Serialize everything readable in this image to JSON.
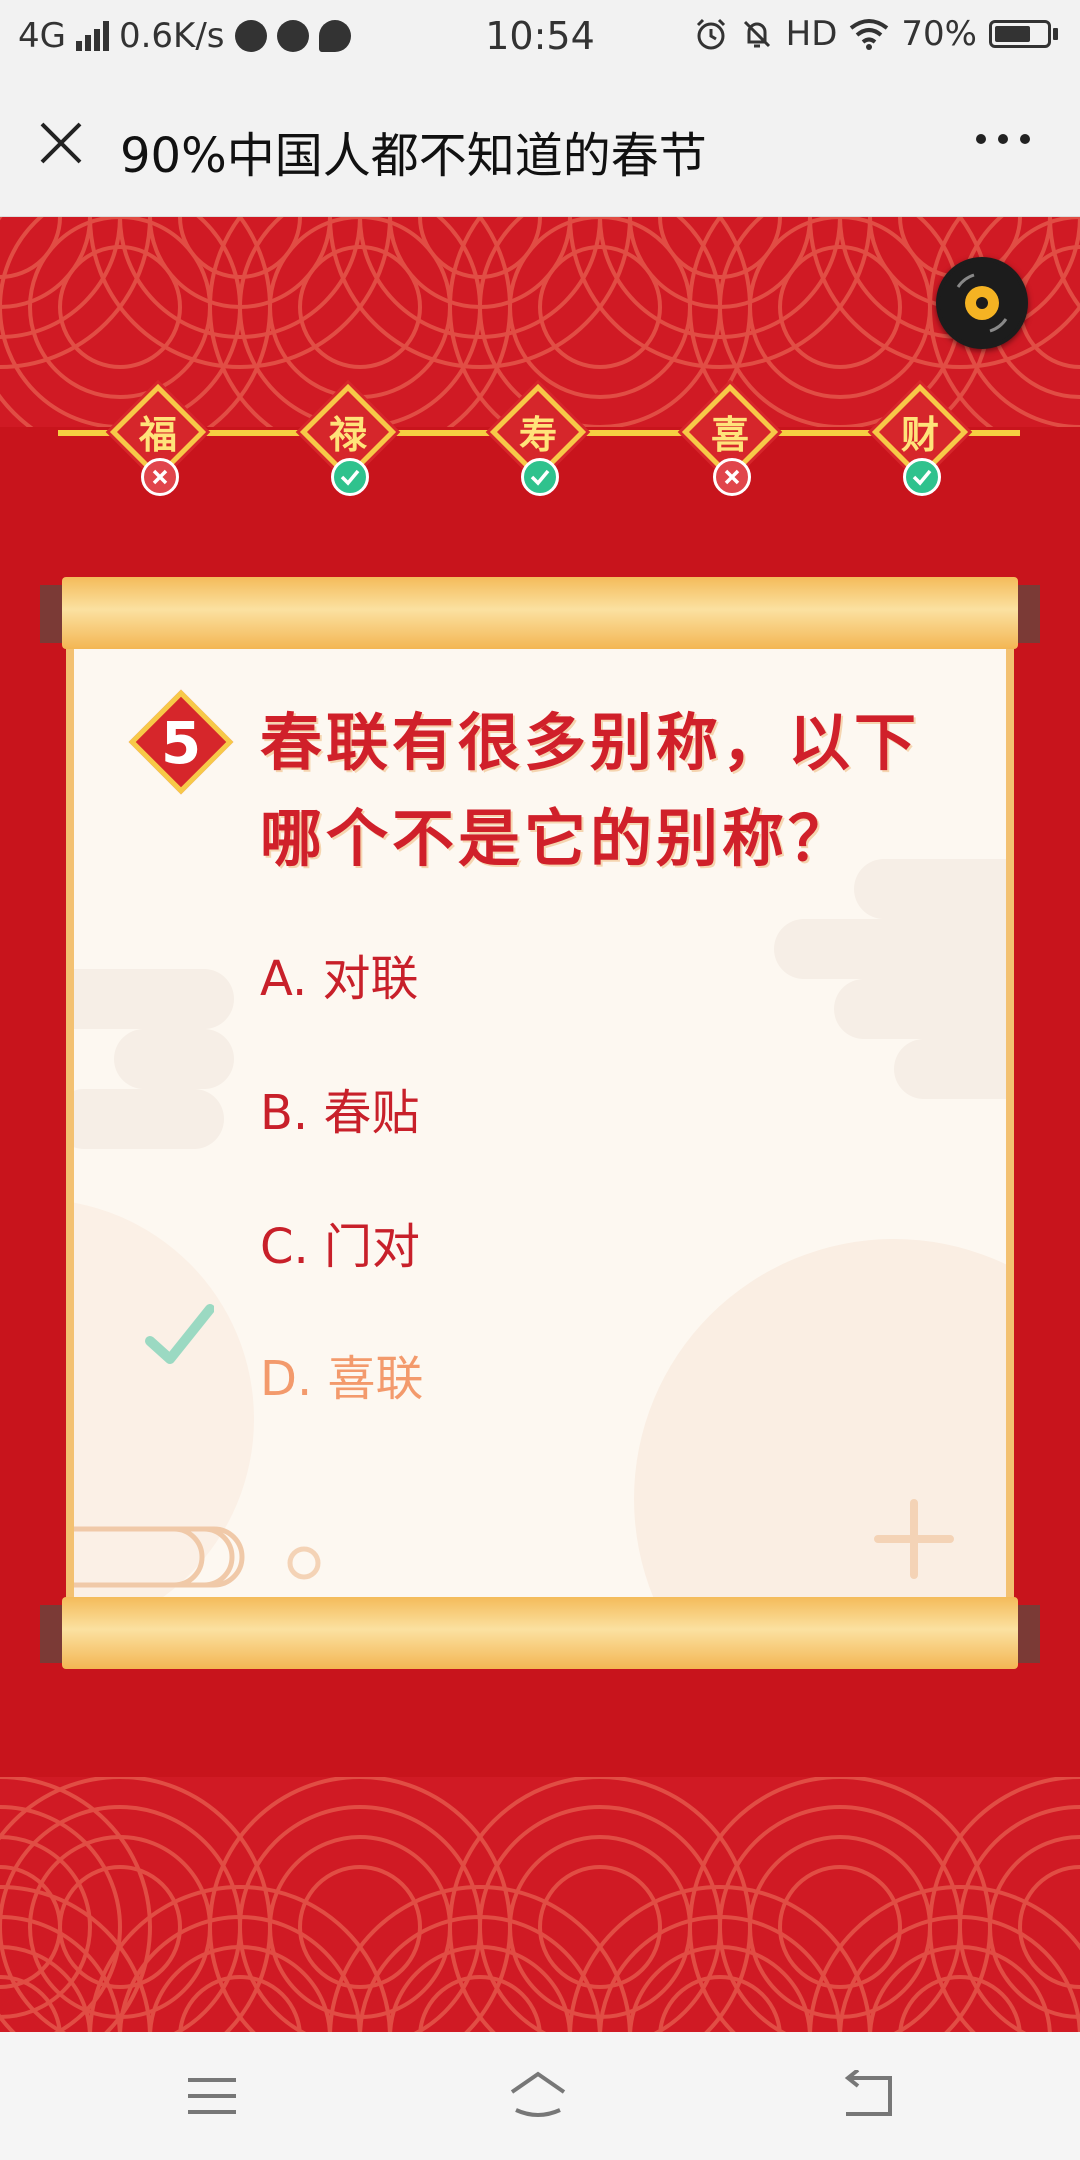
{
  "status_bar": {
    "network": "4G",
    "speed": "0.6K/s",
    "time": "10:54",
    "hd": "HD",
    "battery": "70%"
  },
  "header": {
    "title": "90%中国人都不知道的春节"
  },
  "progress": {
    "nodes": [
      {
        "char": "福",
        "status": "wrong"
      },
      {
        "char": "禄",
        "status": "right"
      },
      {
        "char": "寿",
        "status": "right"
      },
      {
        "char": "喜",
        "status": "wrong"
      },
      {
        "char": "财",
        "status": "right"
      }
    ]
  },
  "quiz": {
    "number": "5",
    "question_line1": "春联有很多别称，以下",
    "question_line2": "哪个不是它的别称？",
    "options": [
      {
        "label": "A. 对联"
      },
      {
        "label": "B. 春贴"
      },
      {
        "label": "C. 门对"
      },
      {
        "label": "D. 喜联",
        "correct": true
      }
    ]
  },
  "colors": {
    "background_red": "#c8141c",
    "accent_gold": "#f7c948",
    "correct_green": "#2fc28d",
    "wrong_red": "#e1454b"
  }
}
